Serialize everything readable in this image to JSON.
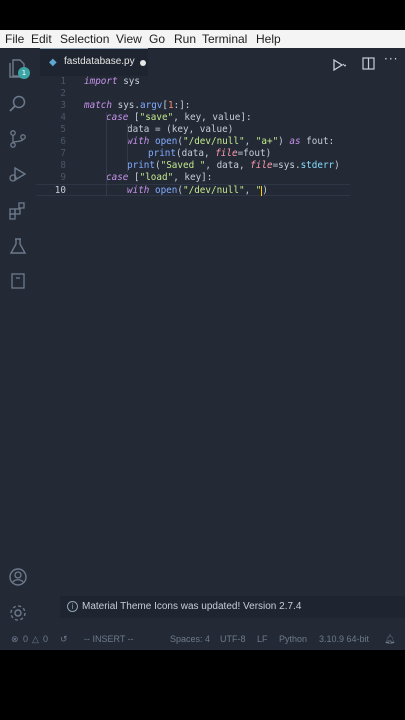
{
  "menu": [
    "File",
    "Edit",
    "Selection",
    "View",
    "Go",
    "Run",
    "Terminal",
    "Help"
  ],
  "tab": {
    "filename": "fastdatabase.py"
  },
  "explorer_badge": "1",
  "lines": [
    {
      "n": "1"
    },
    {
      "n": "2"
    },
    {
      "n": "3"
    },
    {
      "n": "4"
    },
    {
      "n": "5"
    },
    {
      "n": "6"
    },
    {
      "n": "7"
    },
    {
      "n": "8"
    },
    {
      "n": "9"
    },
    {
      "n": "10"
    }
  ],
  "code": {
    "l1_kw": "import",
    "l1_rest": " sys",
    "l3_kw": "match",
    "l3_rest": " sys.",
    "l3_fn": "argv",
    "l3_b1": "[",
    "l3_num": "1",
    "l3_b2": ":]:",
    "l4_kw": "case",
    "l4_b": " [",
    "l4_str": "\"save\"",
    "l4_rest": ", key, value]:",
    "l5": "data = (key, value)",
    "l6_kw": "with",
    "l6_fn": " open",
    "l6_a": "(",
    "l6_s1": "\"/dev/null\"",
    "l6_b": ", ",
    "l6_s2": "\"a+\"",
    "l6_c": ") ",
    "l6_kw2": "as",
    "l6_d": " fout:",
    "l7_fn": "print",
    "l7_a": "(data, ",
    "l7_p": "file",
    "l7_b": "=fout)",
    "l8_fn": "print",
    "l8_a": "(",
    "l8_s": "\"Saved \"",
    "l8_b": ", data, ",
    "l8_p": "file",
    "l8_c": "=sys.",
    "l8_attr": "stderr",
    "l8_d": ")",
    "l9_kw": "case",
    "l9_b": " [",
    "l9_str": "\"load\"",
    "l9_rest": ", key]:",
    "l10_kw": "with",
    "l10_fn": " open",
    "l10_a": "(",
    "l10_s1": "\"/dev/null\"",
    "l10_b": ", ",
    "l10_s2": "\"",
    "l10_c": ")"
  },
  "notification": "Material Theme Icons was updated! Version 2.7.4",
  "status": {
    "errors": "0",
    "warnings": "0",
    "mode": "-- INSERT --",
    "spaces": "Spaces: 4",
    "encoding": "UTF-8",
    "eol": "LF",
    "language": "Python",
    "interpreter": "3.10.9 64-bit"
  },
  "colors": {
    "background": "#232a36",
    "keyword": "#c792ea",
    "string": "#c3e88d",
    "function": "#82aaff",
    "number": "#f78c6c"
  }
}
